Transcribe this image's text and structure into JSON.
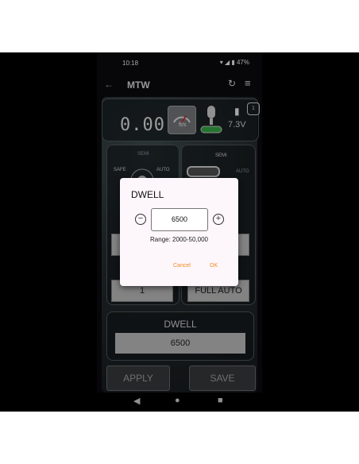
{
  "status": {
    "time": "10:18",
    "battery": "47%"
  },
  "appbar": {
    "title": "MTW"
  },
  "readout": {
    "speed": "0.00",
    "unit": "ft/s",
    "voltage": "7.3V",
    "badge": "1"
  },
  "modes": {
    "left": {
      "top": "SEMI",
      "left": "SAFE",
      "right": "AUTO"
    },
    "right": {
      "top": "SEMI",
      "right": "AUTO"
    }
  },
  "fields": {
    "rate": "1",
    "fire_mode": "FULL AUTO"
  },
  "dwell": {
    "label": "DWELL",
    "value": "6500"
  },
  "buttons": {
    "apply": "APPLY",
    "save": "SAVE"
  },
  "dialog": {
    "title": "DWELL",
    "value": "6500",
    "range": "Range: 2000-50,000",
    "cancel": "Cancel",
    "ok": "OK"
  },
  "colors": {
    "accent": "#f28a1d"
  }
}
